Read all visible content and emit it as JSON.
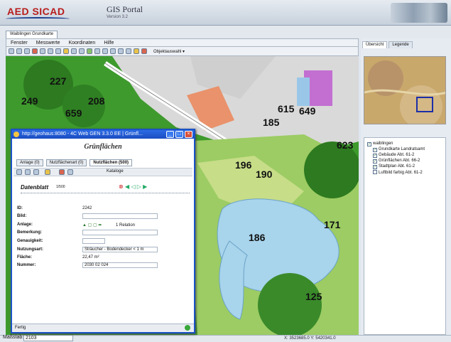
{
  "header": {
    "logo": "AED SICAD",
    "app_title": "GIS Portal",
    "version": "Version 3.2"
  },
  "tab": "Waiblingen Grundkarte",
  "menu": [
    "Fenster",
    "Messwerte",
    "Koordinaten",
    "Hilfe"
  ],
  "toolbar": {
    "object_select": "Objektauswahl"
  },
  "map": {
    "labels": [
      "227",
      "249",
      "208",
      "659",
      "615",
      "649",
      "185",
      "623",
      "196",
      "190",
      "186",
      "171",
      "125"
    ],
    "coords": "X: 3523685.0  Y: 5420341.0"
  },
  "status": {
    "scale_label": "Maßstab: 1:",
    "scale_value": "2103"
  },
  "right_panel": {
    "tabs": [
      "Übersicht",
      "Legende"
    ],
    "layers_root": "waiblingen",
    "layers": [
      {
        "label": "Grundkarte Landratsamt",
        "checked": true
      },
      {
        "label": "Gebäude Abt. 61-2",
        "checked": true
      },
      {
        "label": "Grünflächen Abt. 66-2",
        "checked": true
      },
      {
        "label": "Stadtplan Abt. 61-2",
        "checked": true
      },
      {
        "label": "Luftbild farbig Abt. 61-2",
        "checked": false
      }
    ]
  },
  "popup": {
    "title": "http://geohaus:8080 - 4C Web GEN 3.3.0 EE | Grünfl...",
    "heading": "Grünflächen",
    "tabs": [
      "Anlage (0)",
      "Nutzflächenart (0)",
      "Nutzflächen (500)"
    ],
    "kataloge": "Kataloge",
    "datenblatt": "Datenblatt",
    "page": "1/500",
    "fields": {
      "id_label": "ID:",
      "id_value": "2242",
      "bild_label": "Bild:",
      "anlage_label": "Anlage:",
      "anlage_value": "1 Relation",
      "bemerkung_label": "Bemerkung:",
      "genauigkeit_label": "Genauigkeit:",
      "nutzungsart_label": "Nutzungsart:",
      "nutzungsart_value": "Sträucher - Bodendecker < 1 m",
      "flaeche_label": "Fläche:",
      "flaeche_value": "22,47 m²",
      "nummer_label": "Nummer:",
      "nummer_value": "2030 02 024"
    },
    "status": "Fertig"
  }
}
